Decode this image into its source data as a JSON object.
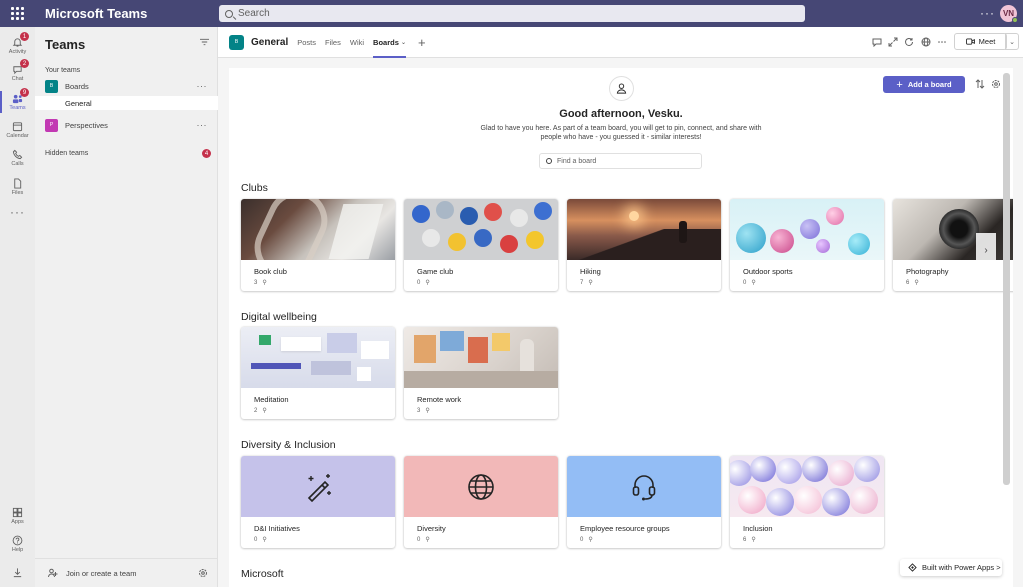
{
  "app": {
    "title": "Microsoft Teams"
  },
  "search": {
    "placeholder": "Search"
  },
  "user": {
    "initials": "VN"
  },
  "rail": [
    {
      "label": "Activity",
      "badge": "1",
      "icon": "bell-icon"
    },
    {
      "label": "Chat",
      "badge": "2",
      "icon": "chat-icon"
    },
    {
      "label": "Teams",
      "badge": "9",
      "icon": "teams-icon"
    },
    {
      "label": "Calendar",
      "badge": "",
      "icon": "calendar-icon"
    },
    {
      "label": "Calls",
      "badge": "",
      "icon": "phone-icon"
    },
    {
      "label": "Files",
      "badge": "",
      "icon": "file-icon"
    },
    {
      "label": "Apps",
      "badge": "",
      "icon": "apps-icon"
    },
    {
      "label": "Help",
      "badge": "",
      "icon": "help-icon"
    }
  ],
  "panel": {
    "title": "Teams",
    "your_teams": "Your teams",
    "teams": [
      {
        "name": "Boards",
        "initial": "B",
        "color": "#038387"
      },
      {
        "name": "Perspectives",
        "initial": "P",
        "color": "#c239b3"
      }
    ],
    "channel": "General",
    "hidden_teams": "Hidden teams",
    "hidden_badge": "4",
    "join": "Join or create a team"
  },
  "channel": {
    "initial": "B",
    "name": "General",
    "tabs": [
      "Posts",
      "Files",
      "Wiki",
      "Boards"
    ],
    "active_tab": "Boards",
    "meet_label": "Meet"
  },
  "boards": {
    "add_board": "Add a board",
    "greeting": "Good afternoon, Vesku.",
    "subtext": "Glad to have you here. As part of a team board, you will get to pin, connect, and share with people who have - you guessed it - similar interests!",
    "find_placeholder": "Find a board",
    "built_with": "Built with Power Apps >",
    "sections": [
      {
        "title": "Clubs",
        "cards": [
          {
            "title": "Book club",
            "count": "3"
          },
          {
            "title": "Game club",
            "count": "0"
          },
          {
            "title": "Hiking",
            "count": "7"
          },
          {
            "title": "Outdoor sports",
            "count": "0"
          },
          {
            "title": "Photography",
            "count": "6"
          }
        ]
      },
      {
        "title": "Digital wellbeing",
        "cards": [
          {
            "title": "Meditation",
            "count": "2"
          },
          {
            "title": "Remote work",
            "count": "3"
          }
        ]
      },
      {
        "title": "Diversity & Inclusion",
        "cards": [
          {
            "title": "D&I Initiatives",
            "count": "0"
          },
          {
            "title": "Diversity",
            "count": "0"
          },
          {
            "title": "Employee resource groups",
            "count": "0"
          },
          {
            "title": "Inclusion",
            "count": "6"
          }
        ]
      },
      {
        "title": "Microsoft",
        "cards": []
      }
    ]
  },
  "colors": {
    "accent": "#5b5fc7",
    "titlebar": "#464775",
    "di_lavender": "#c5c2ea",
    "di_pink": "#f2b8b8",
    "di_blue": "#93bdf5"
  }
}
